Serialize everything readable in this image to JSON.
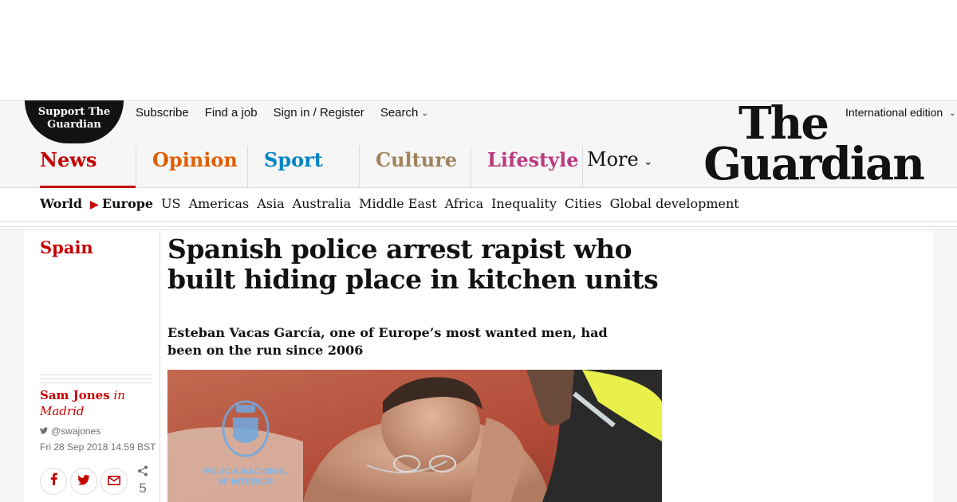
{
  "header": {
    "support_badge": "Support The Guardian",
    "top_links": [
      "Subscribe",
      "Find a job",
      "Sign in / Register",
      "Search"
    ],
    "edition": "International edition",
    "logo_line1": "The",
    "logo_line2": "Guardian",
    "pillars": [
      "News",
      "Opinion",
      "Sport",
      "Culture",
      "Lifestyle",
      "More"
    ]
  },
  "subnav": {
    "items": [
      "World",
      "Europe",
      "US",
      "Americas",
      "Asia",
      "Australia",
      "Middle East",
      "Africa",
      "Inequality",
      "Cities",
      "Global development"
    ]
  },
  "article": {
    "section": "Spain",
    "headline": "Spanish police arrest rapist who built hiding place in kitchen units",
    "standfirst": "Esteban Vacas García, one of Europe’s most wanted men, had been on the run since 2006",
    "author": "Sam Jones",
    "location": "in Madrid",
    "twitter": "@swajones",
    "date": "Fri 28 Sep 2018 14.59 BST",
    "share_count": "5",
    "image_watermark_line1": "POLICIA NACIONAL",
    "image_watermark_line2": "Mº INTERIOR"
  },
  "colors": {
    "news": "#c70000",
    "opinion": "#e05e00",
    "sport": "#0084c6",
    "culture": "#a1845c",
    "lifestyle": "#bb3b80"
  },
  "icons": [
    "chevron-down-icon",
    "twitter-icon",
    "facebook-icon",
    "email-icon",
    "share-icon",
    "triangle-right-icon"
  ]
}
